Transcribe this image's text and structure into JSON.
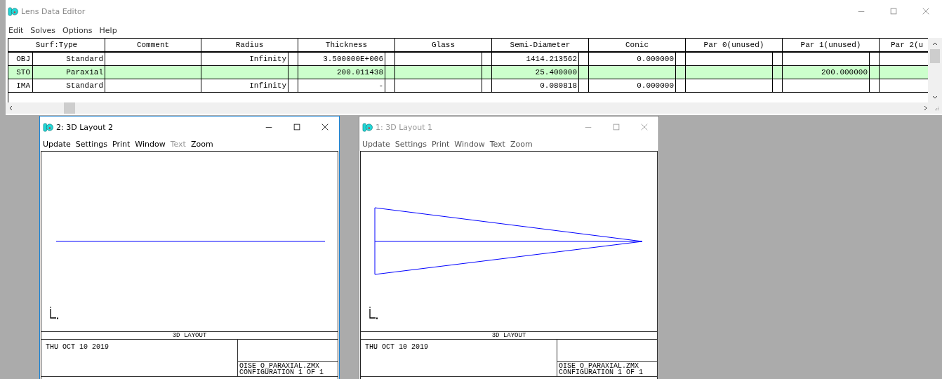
{
  "editor": {
    "title": "Lens Data Editor",
    "active": false,
    "menu": [
      "Edit",
      "Solves",
      "Options",
      "Help"
    ],
    "table": {
      "columns": [
        "Surf:Type",
        "Comment",
        "Radius",
        "Thickness",
        "Glass",
        "Semi-Diameter",
        "Conic",
        "Par 0(unused)",
        "Par 1(unused)",
        "Par 2(u"
      ],
      "rows": [
        {
          "surface": "OBJ",
          "selected": false,
          "cells": [
            "Standard",
            "",
            "Infinity",
            "3.500000E+006",
            "",
            "1414.213562",
            "0.000000",
            "",
            "",
            ""
          ]
        },
        {
          "surface": "STO",
          "selected": true,
          "cells": [
            "Paraxial",
            "",
            "",
            "200.011438",
            "",
            "25.400000",
            "",
            "",
            "200.000000",
            ""
          ]
        },
        {
          "surface": "IMA",
          "selected": false,
          "cells": [
            "Standard",
            "",
            "Infinity",
            "-",
            "",
            "0.080818",
            "0.000000",
            "",
            "",
            ""
          ]
        }
      ]
    }
  },
  "windows": [
    {
      "title": "2: 3D Layout 2",
      "active": true,
      "kind": "line",
      "menu": [
        {
          "label": "Update",
          "disabled": false
        },
        {
          "label": "Settings",
          "disabled": false
        },
        {
          "label": "Print",
          "disabled": false
        },
        {
          "label": "Window",
          "disabled": false
        },
        {
          "label": "Text",
          "disabled": true
        },
        {
          "label": "Zoom",
          "disabled": false
        }
      ],
      "plot_title": "3D LAYOUT",
      "date": "THU OCT 10 2019",
      "file": "OISE O_PARAXIAL.ZMX",
      "config": "CONFIGURATION 1 OF 1"
    },
    {
      "title": "1: 3D Layout 1",
      "active": false,
      "kind": "fan",
      "menu": [
        {
          "label": "Update",
          "disabled": false
        },
        {
          "label": "Settings",
          "disabled": false
        },
        {
          "label": "Print",
          "disabled": false
        },
        {
          "label": "Window",
          "disabled": false
        },
        {
          "label": "Text",
          "disabled": false
        },
        {
          "label": "Zoom",
          "disabled": false
        }
      ],
      "plot_title": "3D LAYOUT",
      "date": "THU OCT 10 2019",
      "file": "OISE O_PARAXIAL.ZMX",
      "config": "CONFIGURATION 1 OF 1"
    }
  ]
}
